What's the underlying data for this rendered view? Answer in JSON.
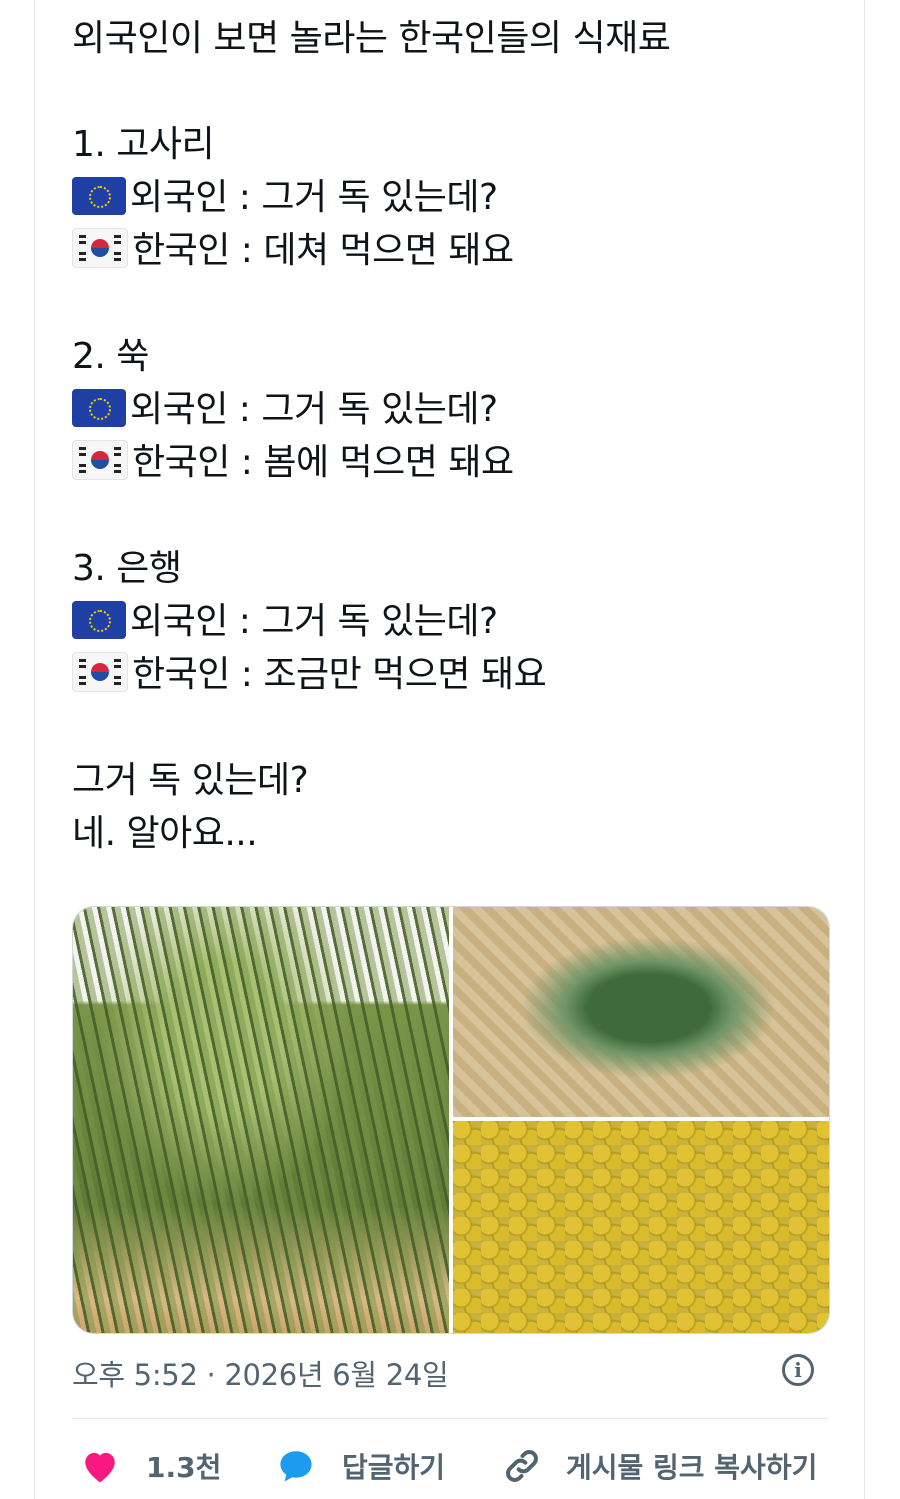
{
  "tweet": {
    "title": "외국인이 보면 놀라는 한국인들의 식재료",
    "items": [
      {
        "heading": "1. 고사리",
        "foreigner_line": "외국인 : 그거 독 있는데?",
        "korean_line": "한국인 : 데쳐 먹으면 돼요"
      },
      {
        "heading": "2. 쑥",
        "foreigner_line": "외국인 : 그거 독 있는데?",
        "korean_line": "한국인 : 봄에 먹으면 돼요"
      },
      {
        "heading": "3. 은행",
        "foreigner_line": "외국인 : 그거 독 있는데?",
        "korean_line": "한국인 : 조금만 먹으면 돼요"
      }
    ],
    "closing_line1": "그거 독 있는데?",
    "closing_line2": "네. 알아요...",
    "flag_foreigner_icon": "eu-flag-icon",
    "flag_korean_icon": "korea-flag-icon"
  },
  "media": {
    "images": [
      "fern-photo",
      "mugwort-photo",
      "ginkgo-photo"
    ]
  },
  "meta": {
    "timestamp": "오후 5:52 · 2026년 6월 24일"
  },
  "actions": {
    "like_count": "1.3천",
    "reply_label": "답글하기",
    "copy_link_label": "게시물 링크 복사하기",
    "like_color": "#f91880",
    "reply_color": "#1d9bf0"
  }
}
